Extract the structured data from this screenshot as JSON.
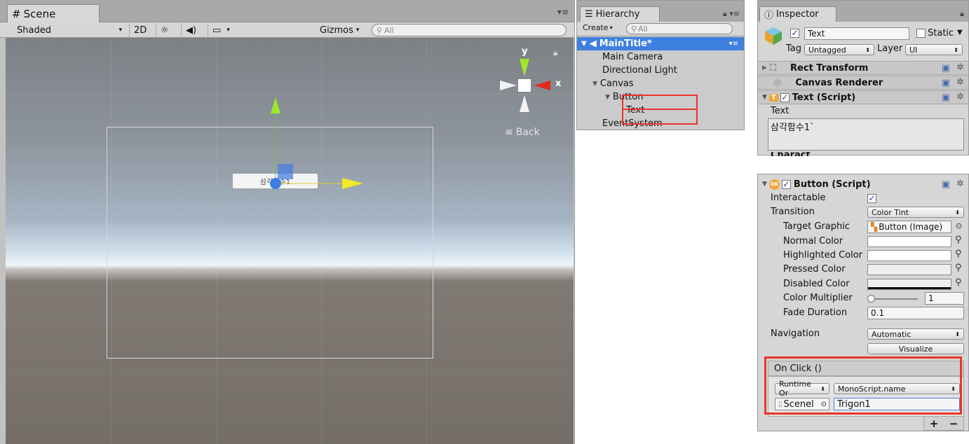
{
  "scene": {
    "tab_label": "Scene",
    "shading_mode": "Shaded",
    "mode_2d": "2D",
    "gizmos_label": "Gizmos",
    "search_placeholder": "All",
    "gizmo_y": "y",
    "gizmo_x": "x",
    "back_label": "Back",
    "button_text": "삼각함수1"
  },
  "hierarchy": {
    "tab_label": "Hierarchy",
    "create_label": "Create",
    "search_placeholder": "All",
    "root": "MainTitle*",
    "items": [
      "Main Camera",
      "Directional Light",
      "Canvas",
      "Button",
      "Text",
      "EventSystem"
    ]
  },
  "inspector": {
    "tab_label": "Inspector",
    "object_name": "Text",
    "static_label": "Static",
    "tag_label": "Tag",
    "tag_value": "Untagged",
    "layer_label": "Layer",
    "layer_value": "UI",
    "components": {
      "rect_transform": "Rect Transform",
      "canvas_renderer": "Canvas Renderer",
      "text_script": "Text (Script)"
    },
    "text_label": "Text",
    "text_value": "삼각함수1`",
    "next_label": "Charact"
  },
  "button_script": {
    "title": "Button (Script)",
    "icon_text": "OK",
    "interactable_label": "Interactable",
    "transition_label": "Transition",
    "transition_value": "Color Tint",
    "target_graphic_label": "Target Graphic",
    "target_graphic_value": "Button (Image)",
    "normal_color_label": "Normal Color",
    "highlighted_color_label": "Highlighted Color",
    "pressed_color_label": "Pressed Color",
    "disabled_color_label": "Disabled Color",
    "color_multiplier_label": "Color Multiplier",
    "color_multiplier_value": "1",
    "color_multiplier_fraction": 0.0,
    "fade_duration_label": "Fade Duration",
    "fade_duration_value": "0.1",
    "navigation_label": "Navigation",
    "navigation_value": "Automatic",
    "visualize_label": "Visualize",
    "onclick_label": "On Click ()",
    "runtime_value": "Runtime Or",
    "function_value": "MonoScript.name",
    "object_value": "Scenel",
    "argument_value": "Trigon1",
    "add_label": "+",
    "remove_label": "−"
  },
  "colors": {
    "selection_blue": "#3d80df",
    "highlight_red": "#e8362b",
    "gizmo_green": "#9ee82c",
    "gizmo_red": "#e12a1e",
    "gizmo_yellow": "#f2e82a"
  }
}
